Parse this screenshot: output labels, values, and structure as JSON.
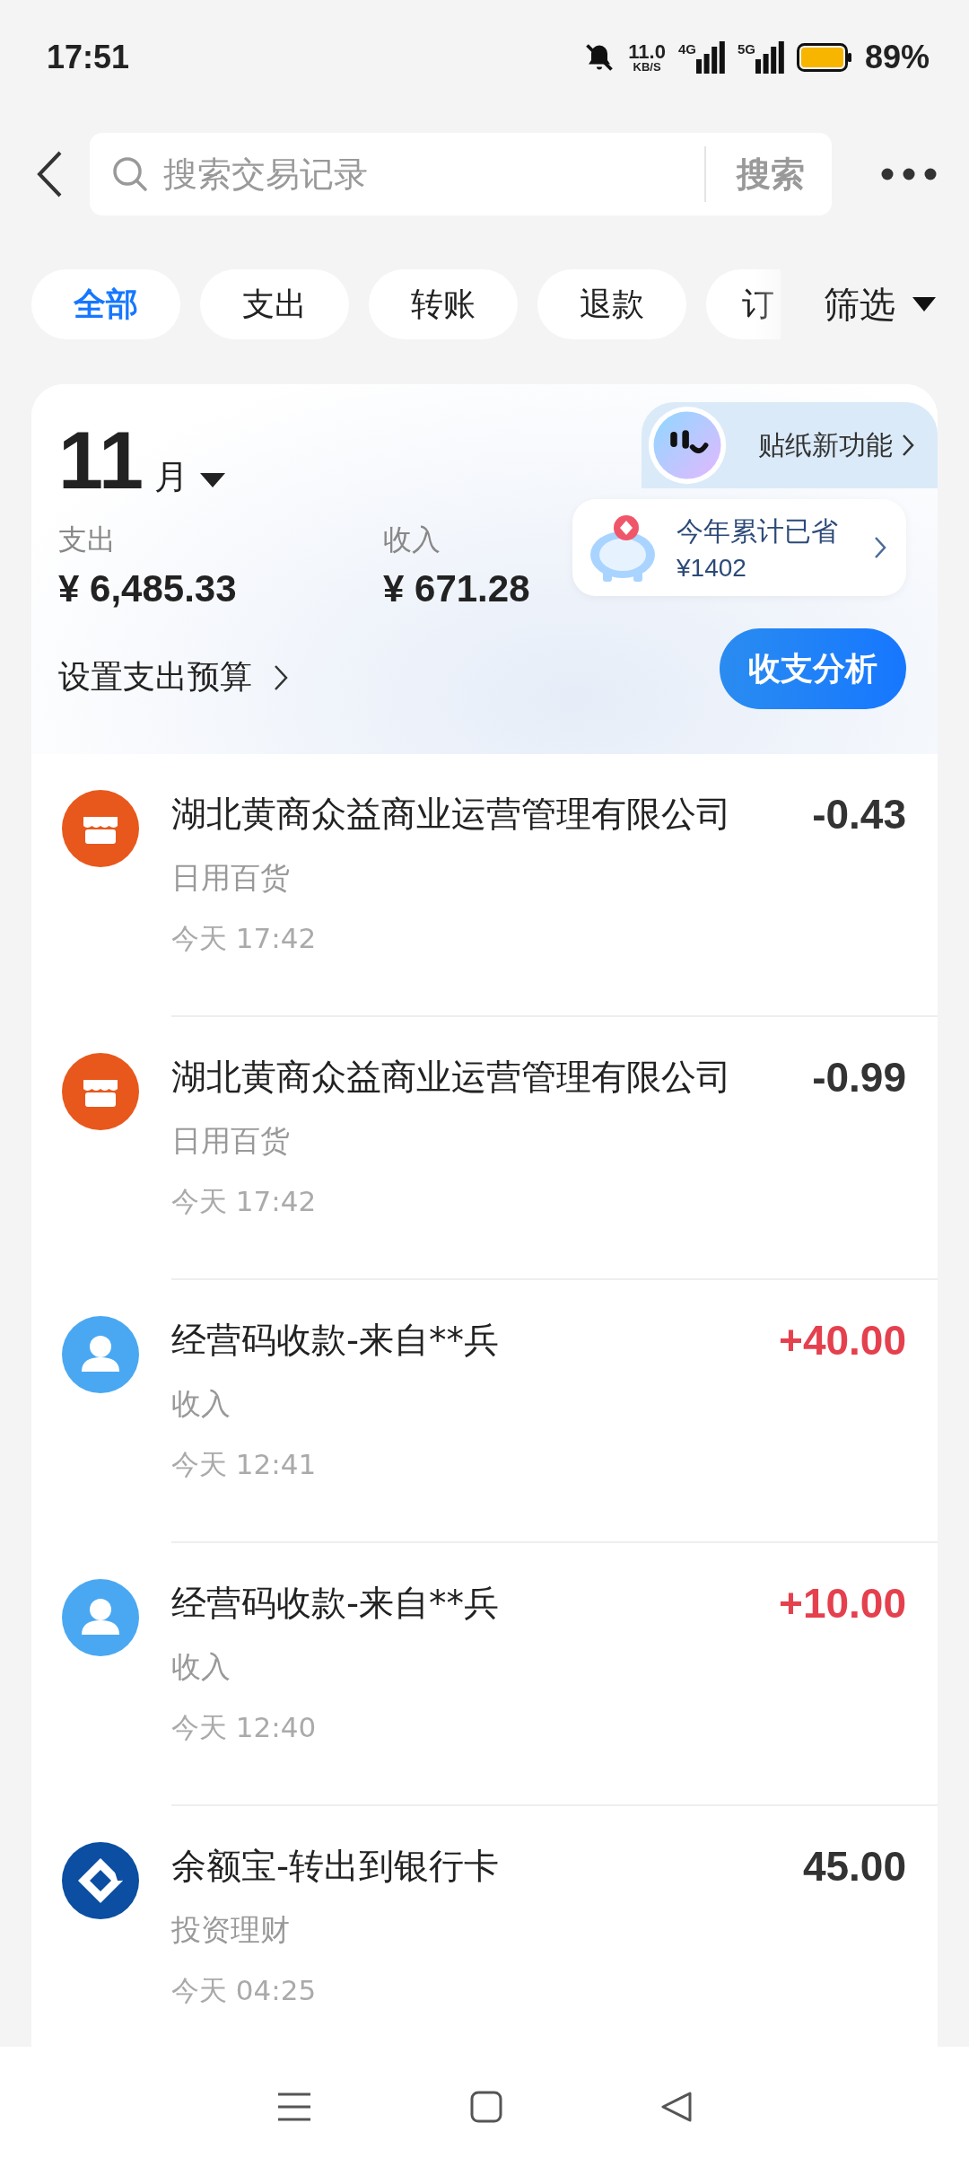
{
  "status_bar": {
    "time": "17:51",
    "net_speed": "11.0",
    "net_unit": "KB/S",
    "signal_1": "4G",
    "signal_2": "5G",
    "battery": "89%"
  },
  "search": {
    "placeholder": "搜索交易记录",
    "button": "搜索"
  },
  "filters": [
    {
      "label": "全部",
      "selected": true
    },
    {
      "label": "支出",
      "selected": false
    },
    {
      "label": "转账",
      "selected": false
    },
    {
      "label": "退款",
      "selected": false
    },
    {
      "label": "订",
      "selected": false
    }
  ],
  "filter_menu": "筛选",
  "summary": {
    "month": "11",
    "month_unit": "月",
    "expense_label": "支出",
    "expense": "¥ 6,485.33",
    "income_label": "收入",
    "income": "¥ 671.28",
    "budget_link": "设置支出预算",
    "sticker_promo": "贴纸新功能",
    "savings_title": "今年累计已省",
    "savings_amount": "¥1402",
    "analysis_button": "收支分析"
  },
  "transactions": [
    {
      "kind": "shop",
      "title": "湖北黄商众益商业运营管理有限公司",
      "category": "日用百货",
      "time": "今天 17:42",
      "amount": "-0.43",
      "income": false
    },
    {
      "kind": "shop",
      "title": "湖北黄商众益商业运营管理有限公司",
      "category": "日用百货",
      "time": "今天 17:42",
      "amount": "-0.99",
      "income": false
    },
    {
      "kind": "person",
      "title": "经营码收款-来自**兵",
      "category": "收入",
      "time": "今天 12:41",
      "amount": "+40.00",
      "income": true
    },
    {
      "kind": "person",
      "title": "经营码收款-来自**兵",
      "category": "收入",
      "time": "今天 12:40",
      "amount": "+10.00",
      "income": true
    },
    {
      "kind": "bank",
      "title": "余额宝-转出到银行卡",
      "category": "投资理财",
      "time": "今天 04:25",
      "amount": "45.00",
      "income": false
    }
  ]
}
